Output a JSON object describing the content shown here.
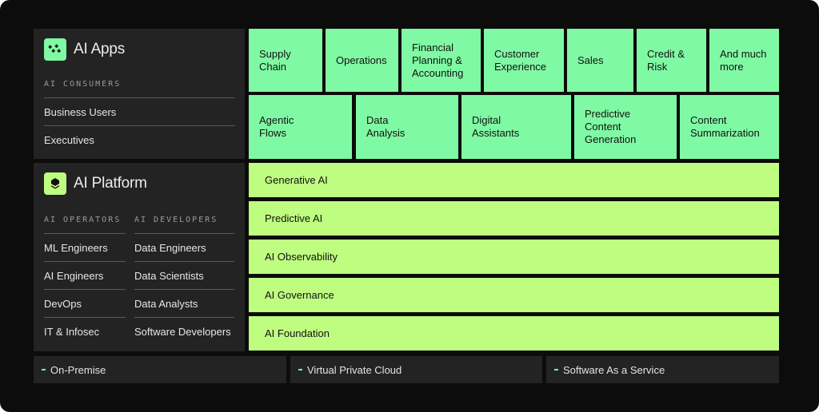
{
  "colors": {
    "background": "#0c0c0c",
    "panel": "#232323",
    "apps_green": "#80f9a4",
    "platform_green": "#bffd81"
  },
  "apps": {
    "title": "AI Apps",
    "icon": "dots-cluster-icon",
    "consumers_label": "AI CONSUMERS",
    "consumers": [
      "Business Users",
      "Executives"
    ],
    "use_cases_row1": [
      "Supply\nChain",
      "Operations",
      "Financial\nPlanning &\nAccounting",
      "Customer\nExperience",
      "Sales",
      "Credit &\nRisk",
      "And much\nmore"
    ],
    "use_cases_row2": [
      "Agentic\nFlows",
      "Data\nAnalysis",
      "Digital\nAssistants",
      "Predictive\nContent\nGeneration",
      "Content\nSummarization"
    ]
  },
  "platform": {
    "title": "AI Platform",
    "icon": "layers-stack-icon",
    "operators_label": "AI OPERATORS",
    "developers_label": "AI DEVELOPERS",
    "operators": [
      "ML Engineers",
      "AI Engineers",
      "DevOps",
      "IT & Infosec"
    ],
    "developers": [
      "Data Engineers",
      "Data Scientists",
      "Data Analysts",
      "Software Developers"
    ],
    "layers": [
      "Generative AI",
      "Predictive AI",
      "AI Observability",
      "AI Governance",
      "AI Foundation"
    ]
  },
  "deployment": [
    "On-Premise",
    "Virtual Private Cloud",
    "Software As a Service"
  ]
}
